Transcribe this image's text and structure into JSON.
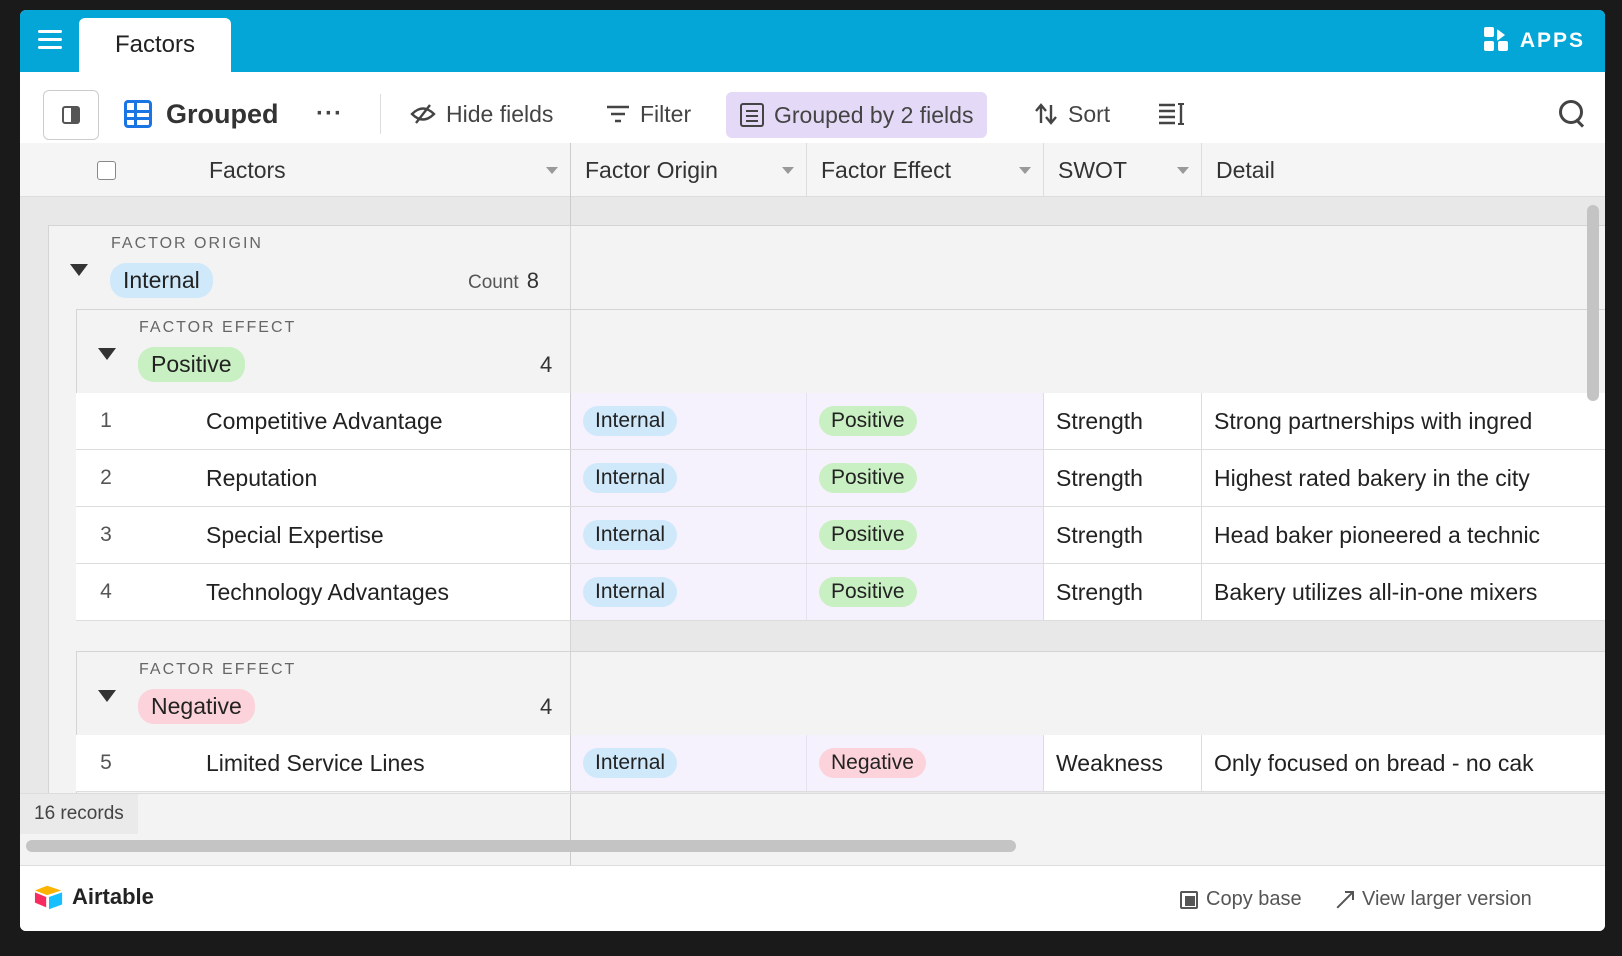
{
  "header": {
    "table_tab": "Factors",
    "apps_label": "APPS"
  },
  "toolbar": {
    "view_name": "Grouped",
    "more": "···",
    "hide_fields": "Hide fields",
    "filter": "Filter",
    "grouped_by": "Grouped by 2 fields",
    "sort": "Sort"
  },
  "columns": [
    "Factors",
    "Factor Origin",
    "Factor Effect",
    "SWOT",
    "Detail"
  ],
  "groups": {
    "outer": {
      "label": "FACTOR ORIGIN",
      "value": "Internal",
      "count_label": "Count",
      "count": "8"
    },
    "inner1": {
      "label": "FACTOR EFFECT",
      "value": "Positive",
      "count": "4"
    },
    "inner2": {
      "label": "FACTOR EFFECT",
      "value": "Negative",
      "count": "4"
    }
  },
  "rows": [
    {
      "num": "1",
      "name": "Competitive Advantage",
      "origin": "Internal",
      "effect": "Positive",
      "swot": "Strength",
      "detail": "Strong partnerships with ingred"
    },
    {
      "num": "2",
      "name": "Reputation",
      "origin": "Internal",
      "effect": "Positive",
      "swot": "Strength",
      "detail": "Highest rated bakery in the city"
    },
    {
      "num": "3",
      "name": "Special Expertise",
      "origin": "Internal",
      "effect": "Positive",
      "swot": "Strength",
      "detail": "Head baker pioneered a technic"
    },
    {
      "num": "4",
      "name": "Technology Advantages",
      "origin": "Internal",
      "effect": "Positive",
      "swot": "Strength",
      "detail": "Bakery utilizes all-in-one mixers"
    },
    {
      "num": "5",
      "name": "Limited Service Lines",
      "origin": "Internal",
      "effect": "Negative",
      "swot": "Weakness",
      "detail": "Only focused on bread - no cak"
    }
  ],
  "footer": {
    "records": "16 records",
    "brand": "Airtable",
    "copy_base": "Copy base",
    "view_larger": "View larger version"
  },
  "colors": {
    "topbar": "#03a6d7",
    "grouped_pill": "#e4d9f7",
    "pill_internal": "#cfe9fb",
    "pill_positive": "#c9f0c2",
    "pill_negative": "#fcd3db"
  }
}
